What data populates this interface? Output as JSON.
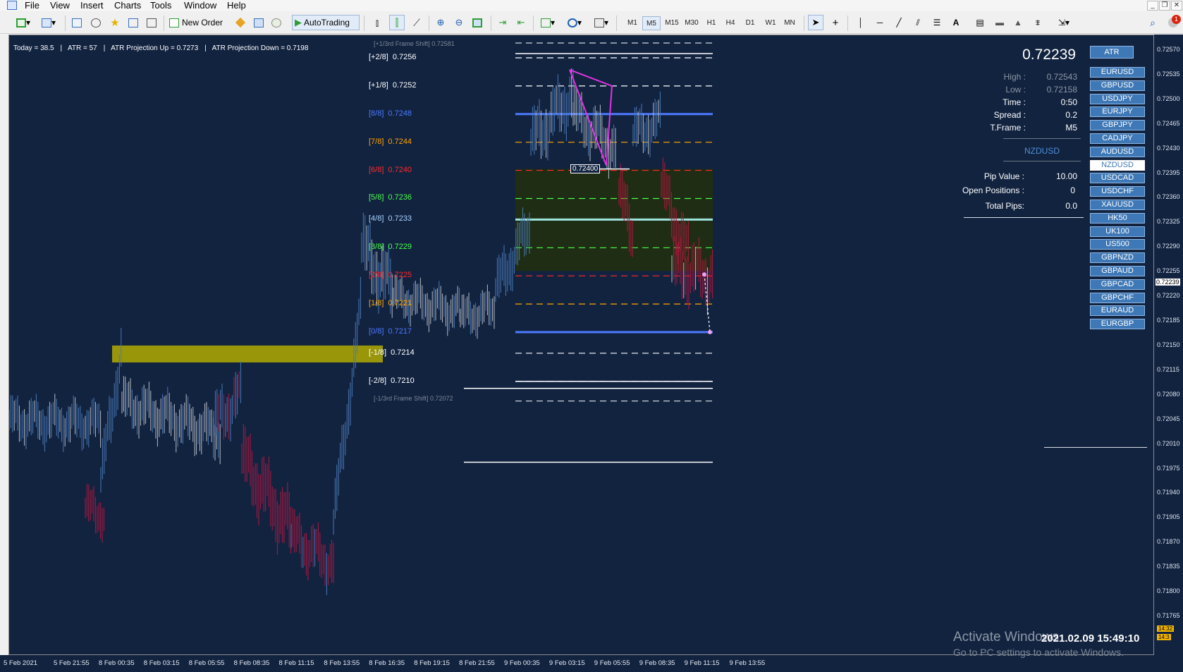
{
  "menu": [
    "File",
    "View",
    "Insert",
    "Charts",
    "Tools",
    "Window",
    "Help"
  ],
  "toolbar": {
    "new_order": "New Order",
    "auto_trading": "AutoTrading",
    "timeframes": [
      "M1",
      "M5",
      "M15",
      "M30",
      "H1",
      "H4",
      "D1",
      "W1",
      "MN"
    ],
    "active_timeframe": "M5",
    "notifications": "1"
  },
  "info_bar": [
    "Today = 38.5",
    "ATR = 57",
    "ATR Projection Up = 0.7273",
    "ATR Projection Down = 0.7198"
  ],
  "murrey": {
    "shift_up": "[+1/3rd Frame Shift]  0.72581",
    "shift_down": "[-1/3rd Frame Shift]  0.72072",
    "levels": [
      {
        "label": "[+2/8]",
        "value": "0.7256",
        "color": "#ffffff"
      },
      {
        "label": "[+1/8]",
        "value": "0.7252",
        "color": "#ffffff"
      },
      {
        "label": "[8/8]",
        "value": "0.7248",
        "color": "#4d79ff"
      },
      {
        "label": "[7/8]",
        "value": "0.7244",
        "color": "#ffa500"
      },
      {
        "label": "[6/8]",
        "value": "0.7240",
        "color": "#ff2b2b"
      },
      {
        "label": "[5/8]",
        "value": "0.7236",
        "color": "#4cff4c"
      },
      {
        "label": "[4/8]",
        "value": "0.7233",
        "color": "#a9d3ff"
      },
      {
        "label": "[3/8]",
        "value": "0.7229",
        "color": "#4cff4c"
      },
      {
        "label": "[2/8]",
        "value": "0.7225",
        "color": "#ff2b2b"
      },
      {
        "label": "[1/8]",
        "value": "0.7221",
        "color": "#ffa500"
      },
      {
        "label": "[0/8]",
        "value": "0.7217",
        "color": "#4d79ff"
      },
      {
        "label": "[-1/8]",
        "value": "0.7214",
        "color": "#ffffff"
      },
      {
        "label": "[-2/8]",
        "value": "0.7210",
        "color": "#ffffff"
      }
    ]
  },
  "price_marker": "0.72400",
  "panel": {
    "price": "0.72239",
    "atr_button": "ATR",
    "high_label": "High :",
    "high_value": "0.72543",
    "low_label": "Low :",
    "low_value": "0.72158",
    "time_label": "Time :",
    "time_value": "0:50",
    "spread_label": "Spread :",
    "spread_value": "0.2",
    "tframe_label": "T.Frame :",
    "tframe_value": "M5",
    "symbol": "NZDUSD",
    "pip_label": "Pip Value :",
    "pip_value": "10.00",
    "openpos_label": "Open Positions :",
    "openpos_value": "0",
    "totalpips_label": "Total Pips:",
    "totalpips_value": "0.0"
  },
  "symbols": [
    "EURUSD",
    "GBPUSD",
    "USDJPY",
    "EURJPY",
    "GBPJPY",
    "CADJPY",
    "AUDUSD",
    "NZDUSD",
    "USDCAD",
    "USDCHF",
    "XAUUSD",
    "HK50",
    "UK100",
    "US500",
    "GBPNZD",
    "GBPAUD",
    "GBPCAD",
    "GBPCHF",
    "EURAUD",
    "EURGBP"
  ],
  "selected_symbol": "NZDUSD",
  "y_axis": [
    "0.72570",
    "0.72535",
    "0.72500",
    "0.72465",
    "0.72430",
    "0.72395",
    "0.72360",
    "0.72325",
    "0.72290",
    "0.72255",
    "0.72220",
    "0.72185",
    "0.72150",
    "0.72115",
    "0.72080",
    "0.72045",
    "0.72010",
    "0.71975",
    "0.71940",
    "0.71905",
    "0.71870",
    "0.71835",
    "0.71800",
    "0.71765"
  ],
  "y_current": "0.72239",
  "x_axis": [
    "5 Feb 2021",
    "5 Feb 21:55",
    "8 Feb 00:35",
    "8 Feb 03:15",
    "8 Feb 05:55",
    "8 Feb 08:35",
    "8 Feb 11:15",
    "8 Feb 13:55",
    "8 Feb 16:35",
    "8 Feb 19:15",
    "8 Feb 21:55",
    "9 Feb 00:35",
    "9 Feb 03:15",
    "9 Feb 05:55",
    "9 Feb 08:35",
    "9 Feb 11:15",
    "9 Feb 13:55"
  ],
  "y_small_tags": [
    "14:32",
    "14:3"
  ],
  "watermark": [
    "Activate Windows",
    "Go to PC settings to activate Windows."
  ],
  "datetime": "2021.02.09 15:49:10",
  "colors": {
    "chart_bg": "#122340",
    "bull": "#4a78b5",
    "bear": "#b3163f",
    "neutral": "#b8bcc4",
    "zone": "#99960a",
    "box": "#1f2d14"
  }
}
